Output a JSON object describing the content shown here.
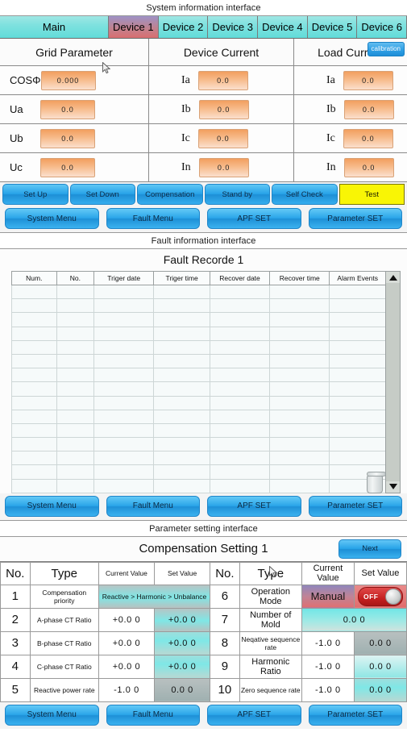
{
  "panel1": {
    "caption": "System information interface",
    "tabs": [
      {
        "label": "Main",
        "active": false
      },
      {
        "label": "Device 1",
        "active": true
      },
      {
        "label": "Device 2",
        "active": false
      },
      {
        "label": "Device 3",
        "active": false
      },
      {
        "label": "Device 4",
        "active": false
      },
      {
        "label": "Device 5",
        "active": false
      },
      {
        "label": "Device 6",
        "active": false
      }
    ],
    "groups": [
      {
        "label": "Grid Parameter"
      },
      {
        "label": "Device Current"
      },
      {
        "label": "Load Current"
      }
    ],
    "calibration_label": "calibration",
    "rows": [
      {
        "g1_label": "COSΦ",
        "g1_value": "0.000",
        "g2_label": "Ia",
        "g2_value": "0.0",
        "g3_label": "Ia",
        "g3_value": "0.0"
      },
      {
        "g1_label": "Ua",
        "g1_value": "0.0",
        "g2_label": "Ib",
        "g2_value": "0.0",
        "g3_label": "Ib",
        "g3_value": "0.0"
      },
      {
        "g1_label": "Ub",
        "g1_value": "0.0",
        "g2_label": "Ic",
        "g2_value": "0.0",
        "g3_label": "Ic",
        "g3_value": "0.0"
      },
      {
        "g1_label": "Uc",
        "g1_value": "0.0",
        "g2_label": "In",
        "g2_value": "0.0",
        "g3_label": "In",
        "g3_value": "0.0"
      }
    ],
    "action_buttons": [
      {
        "label": "Set Up",
        "highlight": false
      },
      {
        "label": "Set Down",
        "highlight": false
      },
      {
        "label": "Compensation",
        "highlight": false
      },
      {
        "label": "Stand by",
        "highlight": false
      },
      {
        "label": "Self Check",
        "highlight": false
      },
      {
        "label": "Test",
        "highlight": true
      }
    ],
    "nav_buttons": [
      "System Menu",
      "Fault Menu",
      "APF SET",
      "Parameter SET"
    ]
  },
  "panel2": {
    "caption": "Fault information interface",
    "title": "Fault Recorde 1",
    "columns": [
      "Num.",
      "No.",
      "Triger date",
      "Triger time",
      "Recover date",
      "Recover time",
      "Alarm Events"
    ],
    "row_count": 15,
    "scroll_up_icon": "arrow-up-icon",
    "scroll_down_icon": "arrow-down-icon",
    "delete_icon": "trash-can-icon",
    "nav_buttons": [
      "System Menu",
      "Fault Menu",
      "APF SET",
      "Parameter SET"
    ]
  },
  "panel3": {
    "caption": "Parameter setting interface",
    "title": "Compensation Setting 1",
    "next_label": "Next",
    "headers": [
      "No.",
      "Type",
      "Current Value",
      "Set Value",
      "No.",
      "Type",
      "Current Value",
      "Set Value"
    ],
    "rows": [
      {
        "left_no": "1",
        "left_type": "Compensation priority",
        "left_span_value": "Reactive > Harmonic > Unbalance",
        "right_no": "6",
        "right_type": "Operation Mode",
        "right_current": "Manual",
        "right_set": "OFF"
      },
      {
        "left_no": "2",
        "left_type": "A-phase CT Ratio",
        "left_current": "+0.0 0",
        "left_set": "+0.0 0",
        "right_no": "7",
        "right_type": "Number of Mold",
        "right_span_value": "0.0 0"
      },
      {
        "left_no": "3",
        "left_type": "B-phase CT Ratio",
        "left_current": "+0.0 0",
        "left_set": "+0.0 0",
        "right_no": "8",
        "right_type": "Neqative sequence  rate",
        "right_current": "-1.0 0",
        "right_set": "0.0 0"
      },
      {
        "left_no": "4",
        "left_type": "C-phase CT Ratio",
        "left_current": "+0.0 0",
        "left_set": "+0.0 0",
        "right_no": "9",
        "right_type": "Harmonic Ratio",
        "right_current": "-1.0 0",
        "right_set": "0.0 0"
      },
      {
        "left_no": "5",
        "left_type": "Reactive power rate",
        "left_current": "-1.0 0",
        "left_set": "0.0 0",
        "right_no": "10",
        "right_type": "Zero sequence rate",
        "right_current": "-1.0 0",
        "right_set": "0.0 0"
      }
    ],
    "nav_buttons": [
      "System Menu",
      "Fault Menu",
      "APF SET",
      "Parameter SET"
    ]
  },
  "colors": {
    "tab_cyan": "#7fe1df",
    "tab_active": "#d96e70",
    "button_blue": "#27a3e8",
    "test_yellow": "#f9f505",
    "value_orange": "#f29f5f",
    "toggle_red": "#c52020",
    "set_cyan": "#7fe7e6"
  }
}
